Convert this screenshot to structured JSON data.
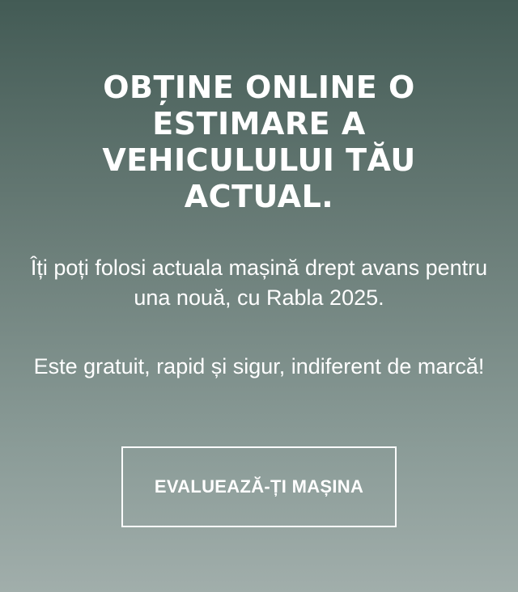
{
  "promo": {
    "headline": "OBȚINE ONLINE O ESTIMARE A VEHICULULUI TĂU ACTUAL.",
    "paragraph_1": "Îți poți folosi actuala mașină drept avans pentru una nouă, cu Rabla 2025.",
    "paragraph_2": "Este gratuit, rapid și sigur, indiferent de marcă!",
    "cta_label": "EVALUEAZĂ-ȚI MAȘINA"
  },
  "colors": {
    "gradient_top": "#435b55",
    "gradient_bottom": "#a1aeab",
    "text": "#ffffff",
    "button_border": "#ffffff"
  }
}
